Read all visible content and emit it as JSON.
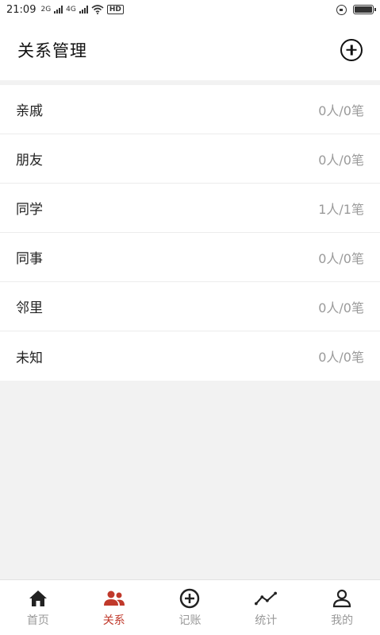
{
  "status_bar": {
    "time": "21:09",
    "network_1": "2G",
    "network_2": "4G",
    "hd_label": "HD",
    "battery_level": 0.9
  },
  "header": {
    "title": "关系管理"
  },
  "relations": [
    {
      "label": "亲戚",
      "count": "0人/0笔"
    },
    {
      "label": "朋友",
      "count": "0人/0笔"
    },
    {
      "label": "同学",
      "count": "1人/1笔"
    },
    {
      "label": "同事",
      "count": "0人/0笔"
    },
    {
      "label": "邻里",
      "count": "0人/0笔"
    },
    {
      "label": "未知",
      "count": "0人/0笔"
    }
  ],
  "tabbar": {
    "active_color": "#c0392b",
    "tabs": [
      {
        "label": "首页",
        "icon": "home-icon",
        "active": false
      },
      {
        "label": "关系",
        "icon": "people-icon",
        "active": true
      },
      {
        "label": "记账",
        "icon": "add-circle-icon",
        "active": false
      },
      {
        "label": "统计",
        "icon": "trend-icon",
        "active": false
      },
      {
        "label": "我的",
        "icon": "user-icon",
        "active": false
      }
    ]
  }
}
